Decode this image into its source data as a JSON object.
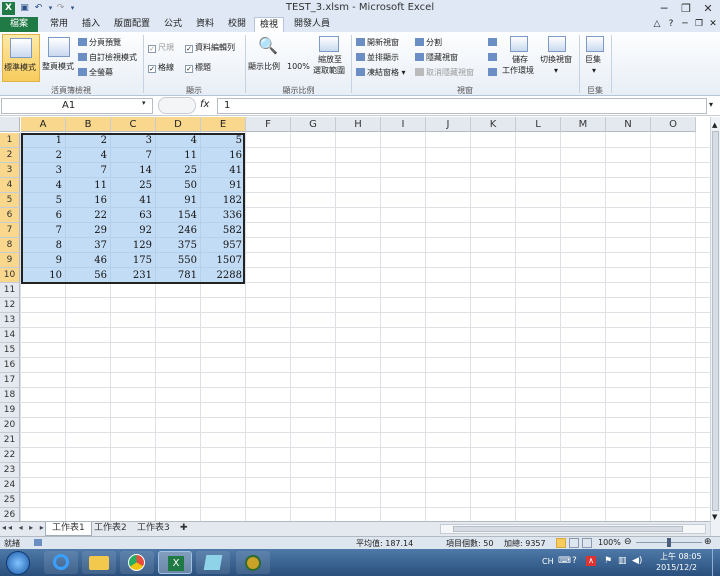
{
  "window": {
    "title": "TEST_3.xlsm - Microsoft Excel"
  },
  "tabs": [
    "檔案",
    "常用",
    "插入",
    "版面配置",
    "公式",
    "資料",
    "校閱",
    "檢視",
    "開發人員"
  ],
  "ribbon": {
    "normal_view": "標準模式",
    "page_layout": "整頁模式",
    "page_break_preview": "分頁預覽",
    "custom_views": "自訂檢視模式",
    "full_screen": "全螢幕",
    "group_workbook_views": "活頁簿檢視",
    "ruler": "尺規",
    "formula_bar": "資料編輯列",
    "gridlines": "格線",
    "headings": "標題",
    "group_show": "顯示",
    "zoom": "顯示比例",
    "zoom_100": "100%",
    "zoom_to_selection_1": "縮放至",
    "zoom_to_selection_2": "選取範圍",
    "group_zoom": "顯示比例",
    "new_window": "開新視窗",
    "arrange_all": "並排顯示",
    "freeze_panes": "凍結窗格",
    "split": "分割",
    "hide": "隱藏視窗",
    "unhide": "取消隱藏視窗",
    "save_workspace_1": "儲存",
    "save_workspace_2": "工作環境",
    "switch_windows": "切換視窗",
    "group_window": "視窗",
    "macros": "巨集",
    "group_macros": "巨集"
  },
  "formula_bar": {
    "name_box": "A1",
    "fx": "fx",
    "value": "1"
  },
  "columns": [
    "A",
    "B",
    "C",
    "D",
    "E",
    "F",
    "G",
    "H",
    "I",
    "J",
    "K",
    "L",
    "M",
    "N",
    "O"
  ],
  "rows": [
    "1",
    "2",
    "3",
    "4",
    "5",
    "6",
    "7",
    "8",
    "9",
    "10",
    "11",
    "12",
    "13",
    "14",
    "15",
    "16",
    "17",
    "18",
    "19",
    "20",
    "21",
    "22",
    "23",
    "24",
    "25",
    "26"
  ],
  "cells": [
    [
      "1",
      "2",
      "3",
      "4",
      "5"
    ],
    [
      "2",
      "4",
      "7",
      "11",
      "16"
    ],
    [
      "3",
      "7",
      "14",
      "25",
      "41"
    ],
    [
      "4",
      "11",
      "25",
      "50",
      "91"
    ],
    [
      "5",
      "16",
      "41",
      "91",
      "182"
    ],
    [
      "6",
      "22",
      "63",
      "154",
      "336"
    ],
    [
      "7",
      "29",
      "92",
      "246",
      "582"
    ],
    [
      "8",
      "37",
      "129",
      "375",
      "957"
    ],
    [
      "9",
      "46",
      "175",
      "550",
      "1507"
    ],
    [
      "10",
      "56",
      "231",
      "781",
      "2288"
    ]
  ],
  "sheets": [
    "工作表1",
    "工作表2",
    "工作表3"
  ],
  "status": {
    "ready": "就緒",
    "average": "平均值: 187.14",
    "count": "項目個數: 50",
    "sum": "加總: 9357",
    "zoom": "100%"
  },
  "taskbar": {
    "lang": "CH",
    "time": "上午 08:05",
    "date": "2015/12/2"
  }
}
